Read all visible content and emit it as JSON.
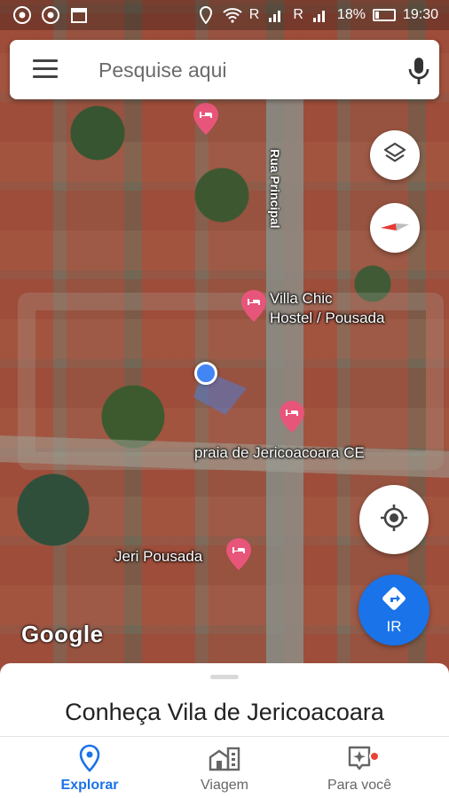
{
  "status_bar": {
    "time": "19:30",
    "battery": "18%",
    "carrier_1": "R",
    "carrier_2": "R",
    "icons": [
      "chrome-icon",
      "chrome-icon",
      "calendar-icon",
      "location-icon",
      "wifi-icon",
      "signal-icon",
      "signal-icon",
      "battery-icon"
    ]
  },
  "search": {
    "placeholder": "Pesquise aqui"
  },
  "map": {
    "street_label": "Rua Principal",
    "pois": [
      {
        "name": "Villa Chic Hostel / Pousada"
      },
      {
        "name": "praia de Jericoacoara CE"
      },
      {
        "name": "Jeri Pousada"
      },
      {
        "name": ""
      }
    ],
    "poi_label_lines": {
      "villa_line1": "Villa Chic",
      "villa_line2": "Hostel / Pousada"
    },
    "attribution": "Google",
    "pin_color": "#e8557a",
    "my_location_color": "#4285f4"
  },
  "buttons": {
    "go_label": "IR",
    "go_color": "#1a73e8"
  },
  "sheet": {
    "title": "Conheça Vila de Jericoacoara"
  },
  "nav": {
    "items": [
      {
        "label": "Explorar",
        "active": true
      },
      {
        "label": "Viagem",
        "active": false
      },
      {
        "label": "Para você",
        "active": false
      }
    ],
    "active_color": "#1a73e8"
  }
}
